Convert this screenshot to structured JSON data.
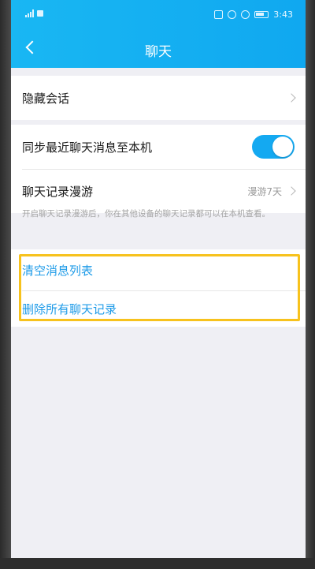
{
  "status_bar": {
    "time": "3:43"
  },
  "nav": {
    "title": "聊天"
  },
  "section1": {
    "hidden_chats_label": "隐藏会话"
  },
  "section2": {
    "sync_label": "同步最近聊天消息至本机",
    "sync_enabled": true,
    "roaming_label": "聊天记录漫游",
    "roaming_value": "漫游7天"
  },
  "hint": {
    "text": "开启聊天记录漫游后，你在其他设备的聊天记录都可以在本机查看。"
  },
  "section3": {
    "clear_list_label": "清空消息列表",
    "delete_all_label": "删除所有聊天记录"
  },
  "colors": {
    "header": "#19b7f3",
    "accent": "#14a9f1",
    "link": "#1e9be8",
    "highlight": "#f7c21d"
  }
}
